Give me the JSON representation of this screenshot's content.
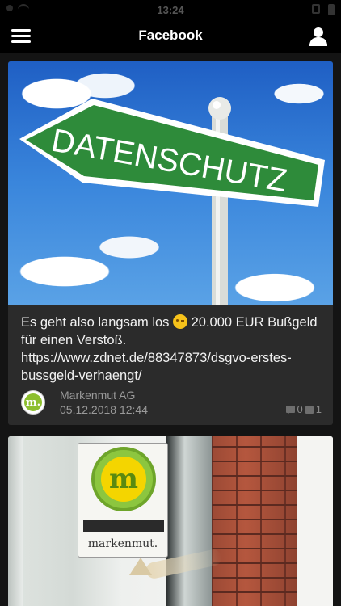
{
  "status_bar": {
    "time": "13:24"
  },
  "nav": {
    "title": "Facebook",
    "menu_icon": "hamburger-menu-icon",
    "profile_icon": "user-profile-icon"
  },
  "posts": [
    {
      "image_text": "DATENSCHUTZ",
      "text_before_emoji": "Es geht also langsam los ",
      "emoji": "winking-face-emoji",
      "text_after_emoji": " 20.000 EUR Bußgeld für einen Verstoß. https://www.zdnet.de/88347873/dsgvo-erstes-bussgeld-verhaengt/",
      "author": "Markenmut AG",
      "date": "05.12.2018 12:44",
      "comments": "0",
      "likes": "1",
      "avatar_letter": "m."
    },
    {
      "logo_letter": "m",
      "logo_text": "markenmut."
    }
  ],
  "colors": {
    "sign_green": "#2e8b3a",
    "brand_green": "#8cc63f",
    "brand_yellow": "#f4d500"
  }
}
